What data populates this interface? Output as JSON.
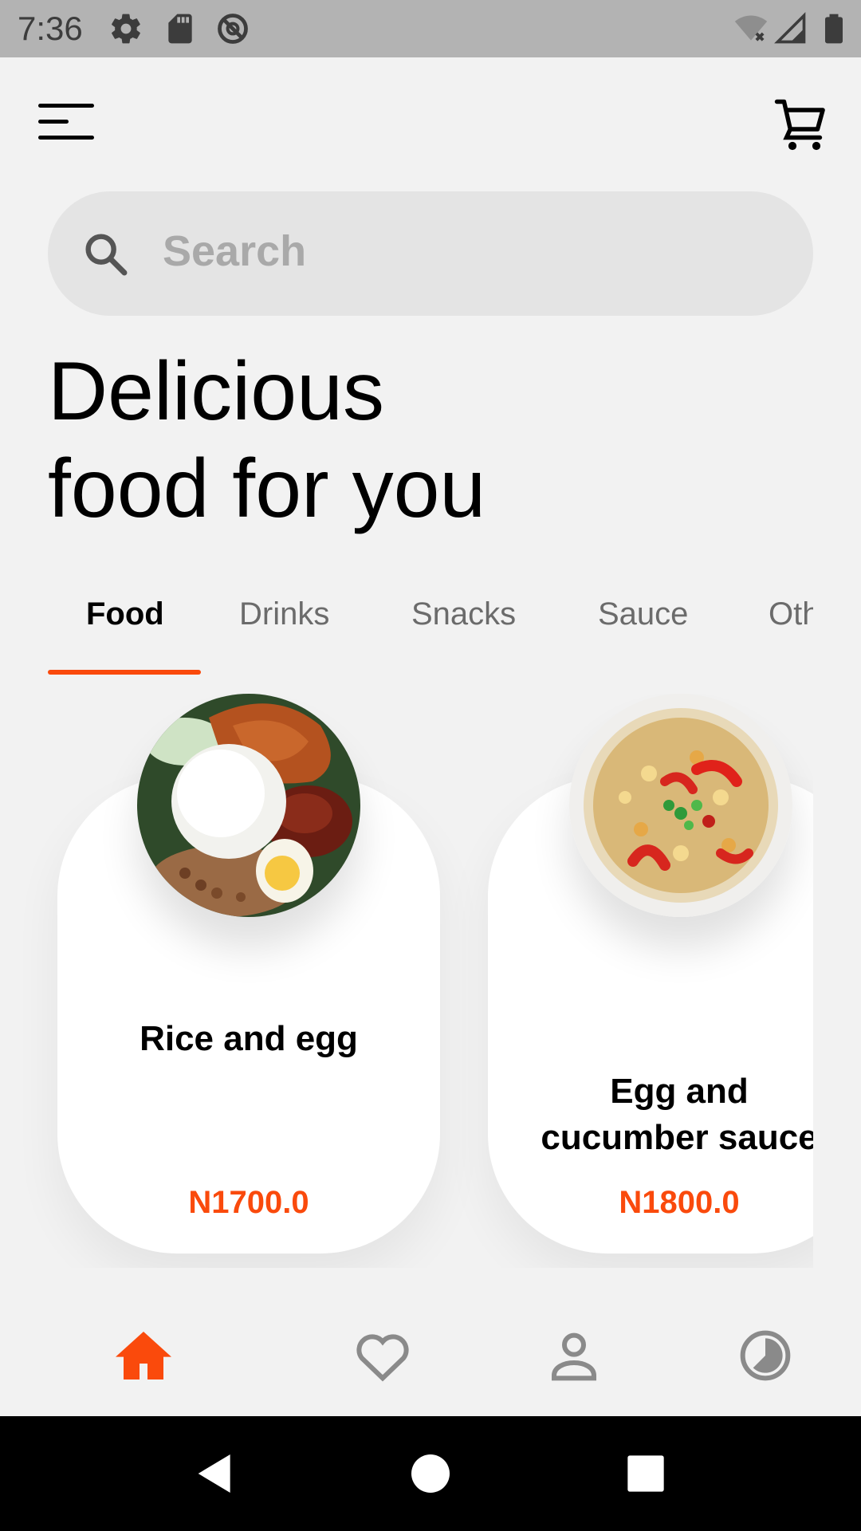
{
  "status_bar": {
    "time": "7:36",
    "icons": [
      "gear-icon",
      "sd-card-icon",
      "do-not-disturb-icon",
      "wifi-off-icon",
      "signal-icon",
      "battery-icon"
    ]
  },
  "app_bar": {
    "menu_icon": "hamburger-menu-icon",
    "cart_icon": "cart-icon"
  },
  "search": {
    "placeholder": "Search",
    "icon": "search-icon"
  },
  "headline": {
    "line1": "Delicious",
    "line2": "food for you"
  },
  "tabs": [
    {
      "label": "Food",
      "active": true
    },
    {
      "label": "Drinks",
      "active": false
    },
    {
      "label": "Snacks",
      "active": false
    },
    {
      "label": "Sauce",
      "active": false
    },
    {
      "label": "Oth",
      "active": false
    }
  ],
  "products": [
    {
      "name_line1": "Rice and egg",
      "name_line2": "",
      "price": "N1700.0"
    },
    {
      "name_line1": "Egg and",
      "name_line2": "cucumber sauce",
      "price": "N1800.0"
    }
  ],
  "bottom_nav": [
    {
      "icon": "home-icon",
      "active": true
    },
    {
      "icon": "heart-icon",
      "active": false
    },
    {
      "icon": "profile-icon",
      "active": false
    },
    {
      "icon": "history-icon",
      "active": false
    }
  ],
  "colors": {
    "accent": "#fa4a0c",
    "background": "#f2f2f2",
    "inactive_icon": "#8a8a8a"
  }
}
